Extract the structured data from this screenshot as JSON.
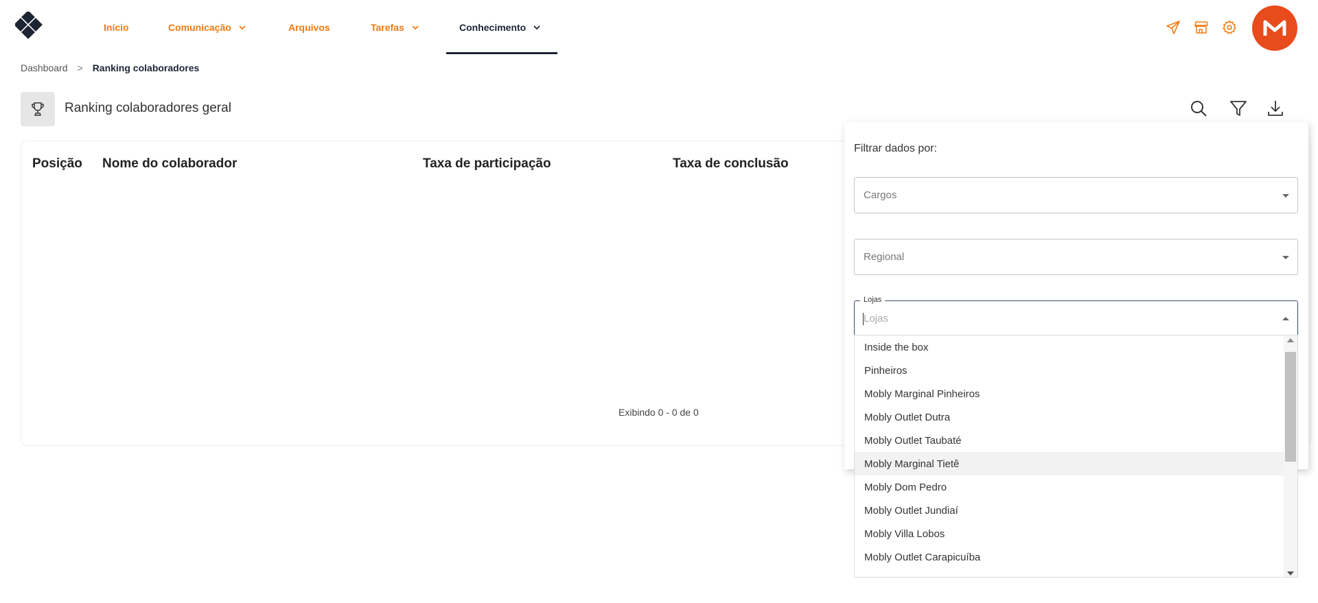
{
  "nav": {
    "items": [
      {
        "label": "Início"
      },
      {
        "label": "Comunicação"
      },
      {
        "label": "Arquivos"
      },
      {
        "label": "Tarefas"
      },
      {
        "label": "Conhecimento"
      }
    ],
    "active": "Conhecimento",
    "accent_color": "#f07a12",
    "active_color": "#1d2433",
    "avatar_color": "#e84b1c"
  },
  "breadcrumb": {
    "root": "Dashboard",
    "separator": ">",
    "current": "Ranking colaboradores"
  },
  "page": {
    "title": "Ranking colaboradores geral"
  },
  "table": {
    "columns": [
      "Posição",
      "Nome do colaborador",
      "Taxa de participação",
      "Taxa de conclusão"
    ],
    "rows": [],
    "pagination": "Exibindo 0 - 0 de 0"
  },
  "filter": {
    "title": "Filtrar dados por:",
    "cargos_placeholder": "Cargos",
    "regional_placeholder": "Regional",
    "lojas_label": "Lojas",
    "lojas_placeholder": "Lojas",
    "options": [
      "Inside the box",
      "Pinheiros",
      "Mobly Marginal Pinheiros",
      "Mobly Outlet Dutra",
      "Mobly Outlet Taubaté",
      "Mobly Marginal Tietê",
      "Mobly Dom Pedro",
      "Mobly Outlet Jundiaí",
      "Mobly Villa Lobos",
      "Mobly Outlet Carapicuíba"
    ],
    "hovered_option": "Mobly Marginal Tietê"
  }
}
